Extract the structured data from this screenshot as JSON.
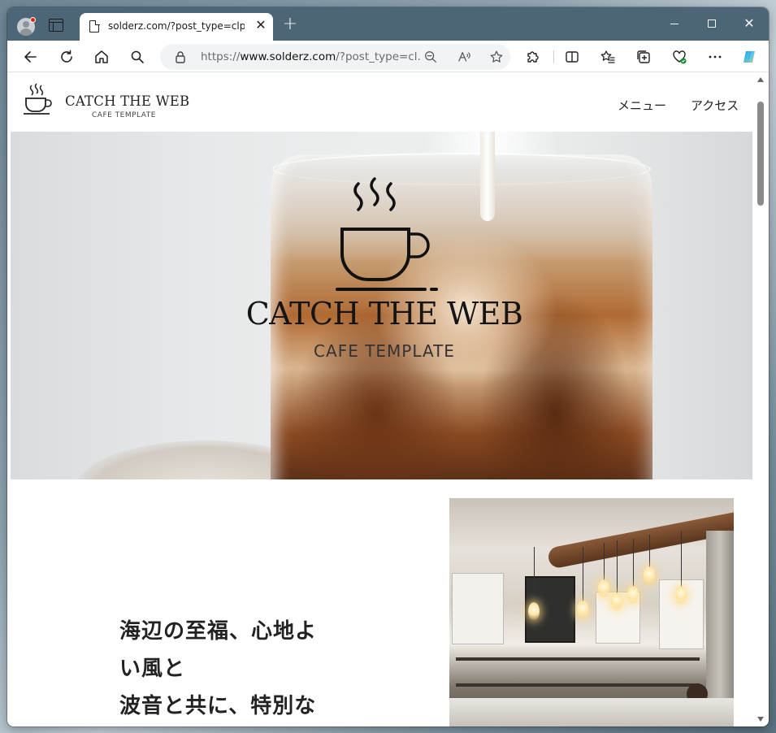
{
  "browser": {
    "tab_title": "solderz.com/?post_type=clp&p=",
    "tab_close": "✕",
    "new_tab": "+",
    "url_prefix": "https://",
    "url_host": "www.solderz.com",
    "url_path": "/?post_type=cl...",
    "window_close": "✕"
  },
  "site": {
    "logo_title": "CATCH THE WEB",
    "logo_subtitle": "CAFE TEMPLATE",
    "nav": [
      {
        "label": "メニュー"
      },
      {
        "label": "アクセス"
      }
    ],
    "hero_title": "CATCH THE WEB",
    "hero_subtitle": "CAFE TEMPLATE",
    "intro_lines": [
      "海辺の至福、心地よ",
      "い風と",
      "波音と共に、特別な"
    ]
  }
}
